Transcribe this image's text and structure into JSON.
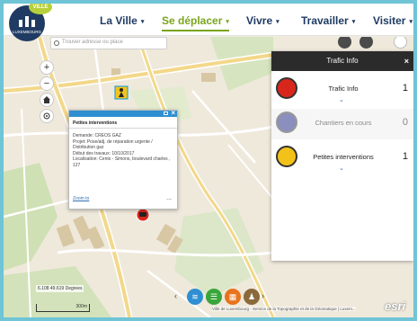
{
  "logo": {
    "ribbon_text": "VILLE",
    "caption": "LUXEMBOURG",
    "colors": {
      "badge": "#1f3b63",
      "ribbon": "#b7cf3a"
    }
  },
  "nav": {
    "items": [
      {
        "label": "La Ville",
        "active": false
      },
      {
        "label": "Se déplacer",
        "active": true
      },
      {
        "label": "Vivre",
        "active": false
      },
      {
        "label": "Travailler",
        "active": false
      },
      {
        "label": "Visiter",
        "active": false
      }
    ],
    "caret": "▾"
  },
  "search": {
    "placeholder": "Trouver adresse ou place"
  },
  "map_controls": {
    "zoom_in": "+",
    "zoom_out": "−"
  },
  "popup": {
    "title": "Petites interventions",
    "lines": [
      "Demande: CREOS GAZ",
      "Projet: Pose/adj. de réparation urgente / Distribution gaz",
      "Début des travaux: 10/10/2017",
      "Localisation: Cents - Simons, boulevard charles , 127"
    ],
    "zoom_link": "Zoom to",
    "more": "..."
  },
  "panel": {
    "title": "Trafic Info",
    "close": "×",
    "rows": [
      {
        "label": "Trafic Info",
        "count": "1",
        "icon": "car-alert-icon",
        "color": "#d9261c",
        "dim": false
      },
      {
        "label": "Chantiers en cours",
        "count": "0",
        "icon": "construction-sign-icon",
        "color": "#8a8fbd",
        "dim": true
      },
      {
        "label": "Petites interventions",
        "count": "1",
        "icon": "worker-icon",
        "color": "#f3c21a",
        "dim": false
      }
    ],
    "chevron": "⌄"
  },
  "toolbar": {
    "left_arrow": "‹",
    "right_arrow": "›",
    "buttons": [
      {
        "icon": "layers-icon",
        "color": "#2f8fd1"
      },
      {
        "icon": "list-icon",
        "color": "#3aa53a"
      },
      {
        "icon": "legend-icon",
        "color": "#e8731c"
      },
      {
        "icon": "person-icon",
        "color": "#8a6a3a"
      }
    ]
  },
  "coords": "6.108 49.619 Degrees",
  "scale_label": "300m",
  "attribution": "Ville de Luxembourg - Service de la Topographie et de la Géomatique | Luxem...",
  "esri": "esri"
}
